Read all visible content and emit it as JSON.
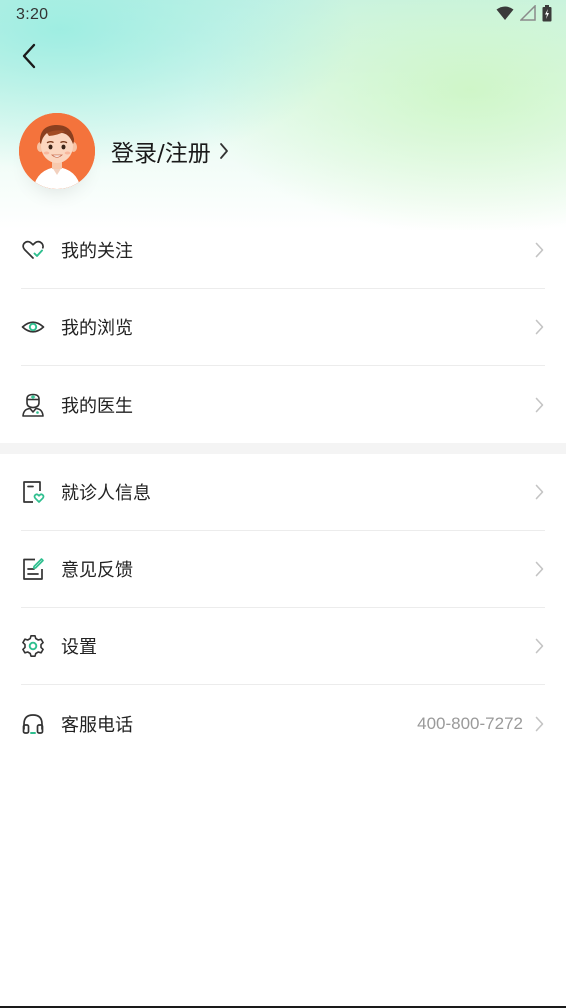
{
  "status_bar": {
    "time": "3:20",
    "icons": [
      "wifi-icon",
      "cellular-signal-icon",
      "battery-icon"
    ]
  },
  "header": {
    "back_icon": "chevron-left-icon",
    "login_label": "登录/注册",
    "avatar_icon": "default-avatar-icon"
  },
  "colors": {
    "accent": "#2fbf8f",
    "avatar_bg": "#f4733c",
    "text_primary": "#222222",
    "text_secondary": "#9a9a9a"
  },
  "menu_group_1": [
    {
      "label": "我的关注",
      "icon": "heart-icon"
    },
    {
      "label": "我的浏览",
      "icon": "eye-icon"
    },
    {
      "label": "我的医生",
      "icon": "doctor-icon"
    }
  ],
  "menu_group_2": [
    {
      "label": "就诊人信息",
      "icon": "patient-info-icon"
    },
    {
      "label": "意见反馈",
      "icon": "feedback-icon"
    },
    {
      "label": "设置",
      "icon": "gear-icon"
    },
    {
      "label": "客服电话",
      "icon": "headset-icon",
      "value": "400-800-7272"
    }
  ]
}
